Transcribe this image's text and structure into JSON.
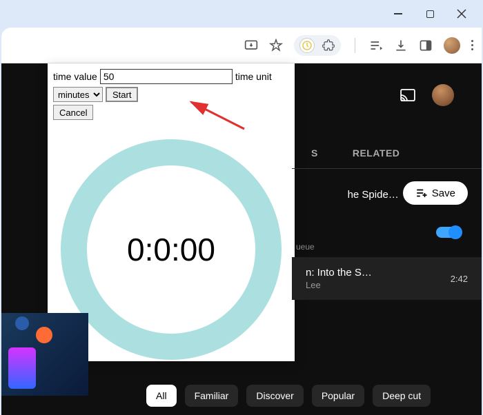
{
  "popup": {
    "time_value_label": "time value",
    "time_value": "50",
    "time_unit_label": "time unit",
    "unit_selected": "minutes",
    "start_label": "Start",
    "cancel_label": "Cancel",
    "timer_display": "0:0:00"
  },
  "tabs": {
    "t1_suffix": "S",
    "t2": "RELATED"
  },
  "save_button": "Save",
  "title_partial": "he Spide…",
  "queue_partial": "ueue",
  "track": {
    "title_partial": "n: Into the S…",
    "artist_partial": "Lee",
    "duration": "2:42"
  },
  "chips": [
    "All",
    "Familiar",
    "Discover",
    "Popular",
    "Deep cut"
  ]
}
